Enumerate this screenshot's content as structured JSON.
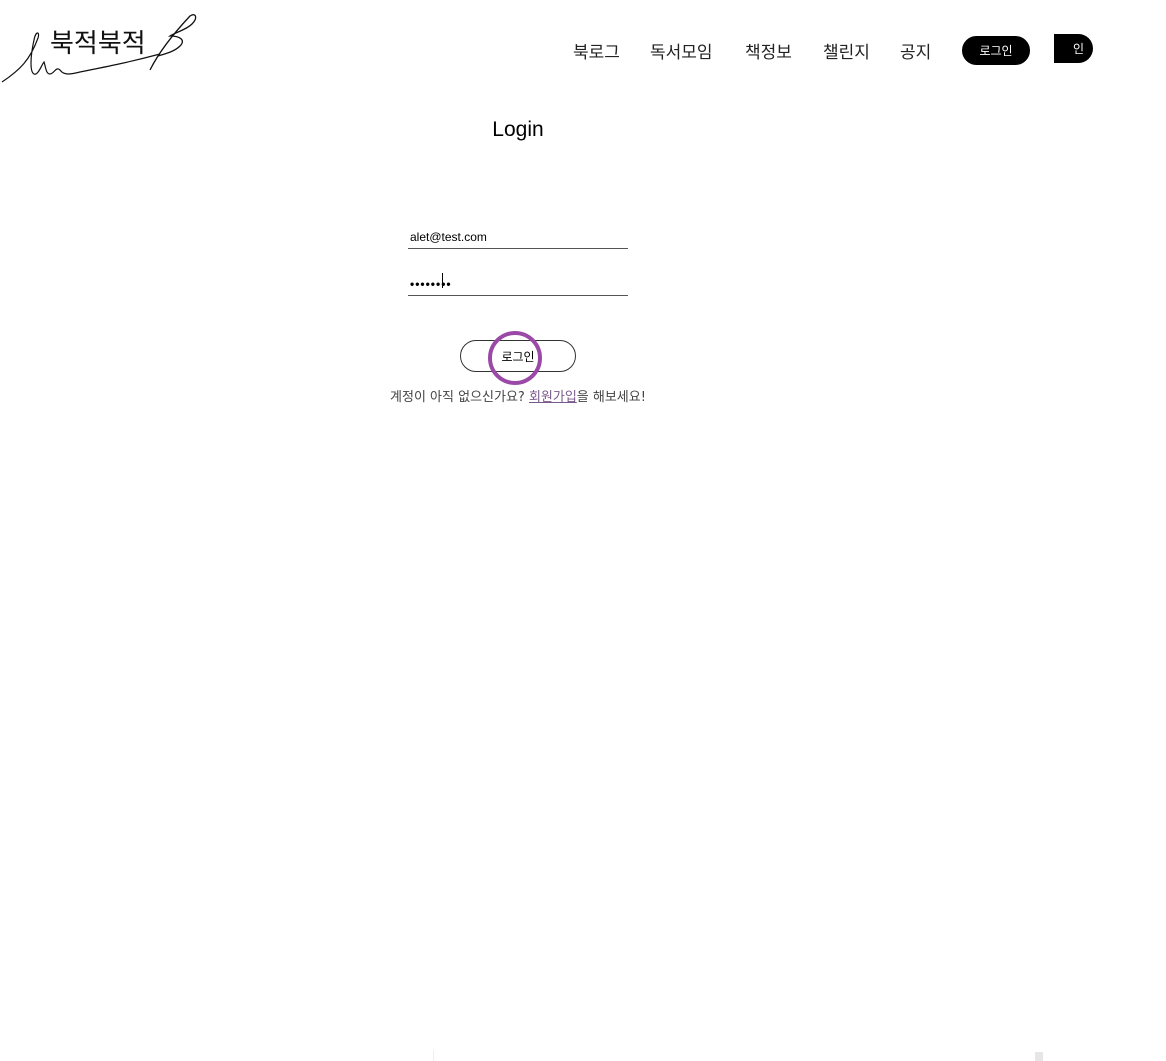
{
  "header": {
    "logo_text": "북적북적",
    "nav": [
      "북로그",
      "독서모임",
      "책정보",
      "챌린지",
      "공지"
    ],
    "login_button": "로그인",
    "partial_button": "인"
  },
  "main": {
    "title": "Login",
    "email_value": "alet@test.com",
    "password_value": "••••••••",
    "submit_label": "로그인",
    "prompt_before": "계정이 아직 없으신가요? ",
    "signup_link": "회원가입",
    "prompt_after": "을 해보세요!"
  },
  "colors": {
    "accent_ring": "#9a4aa6",
    "link": "#7a5a8a"
  }
}
